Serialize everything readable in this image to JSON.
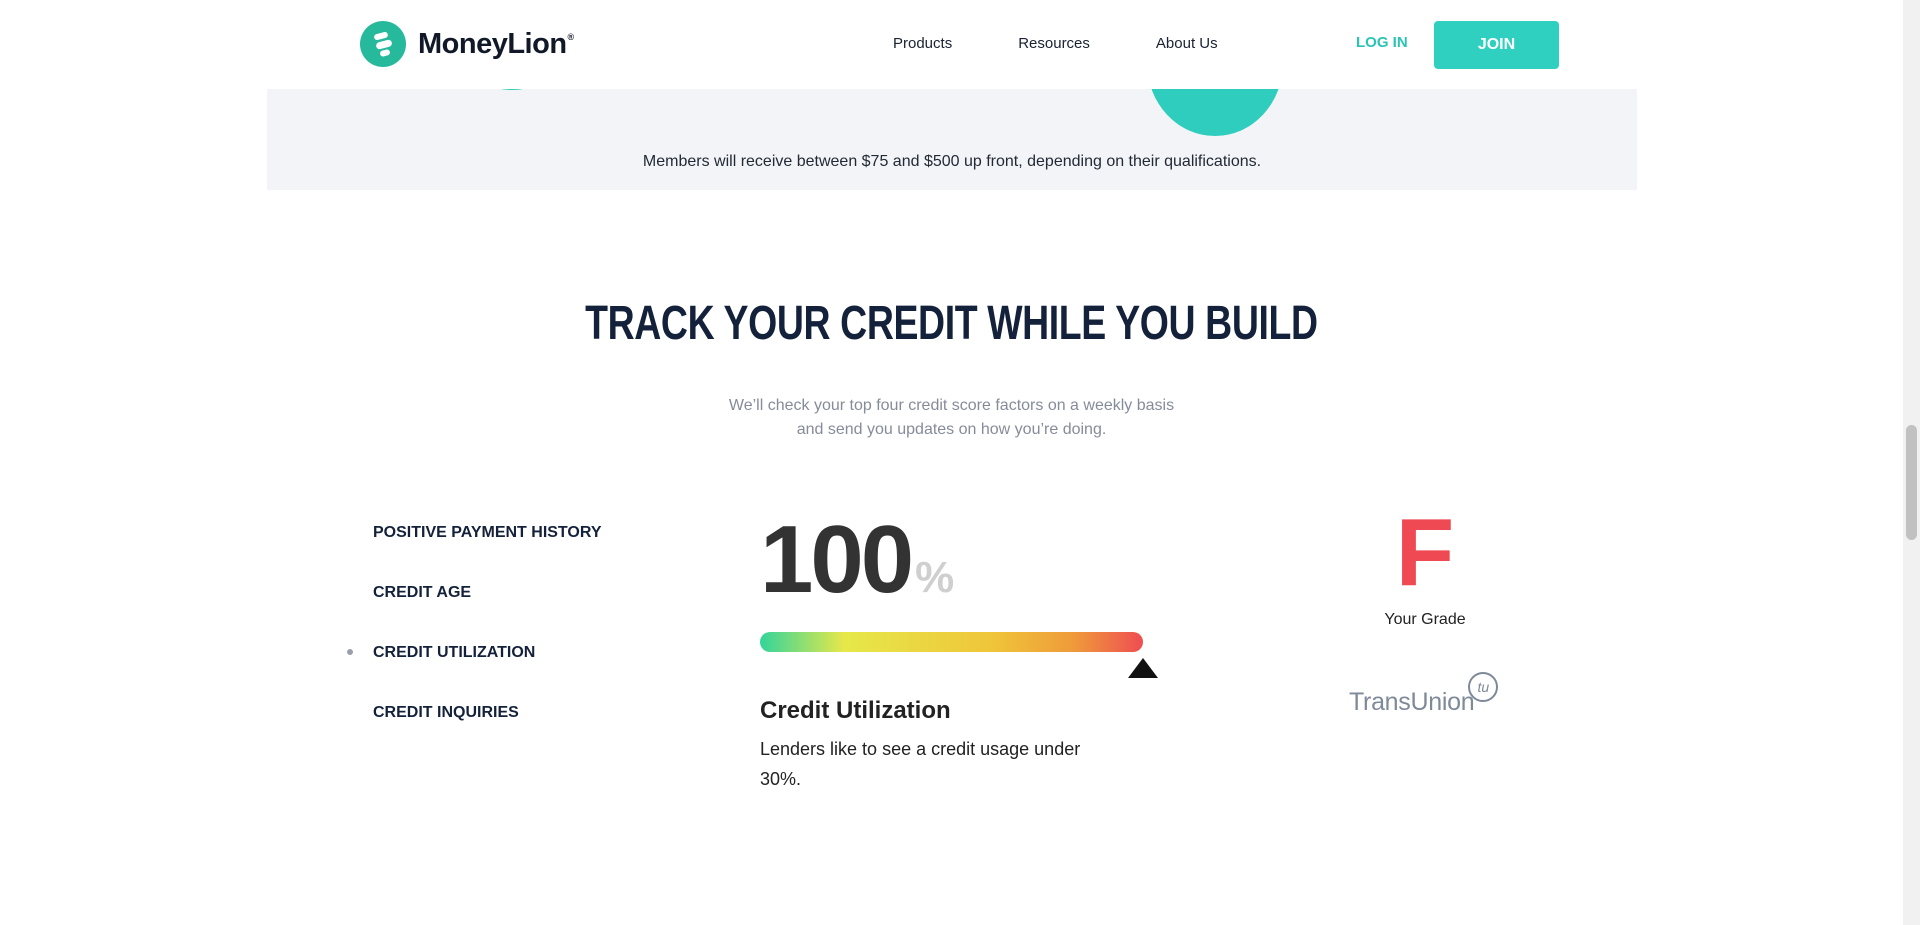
{
  "header": {
    "brand": "MoneyLion",
    "brand_reg": "®",
    "nav": [
      "Products",
      "Resources",
      "About Us"
    ],
    "login": "LOG IN",
    "join": "JOIN"
  },
  "band": {
    "text": "Members will receive between $75 and $500 up front, depending on their qualifications."
  },
  "section": {
    "title": "TRACK YOUR CREDIT WHILE YOU BUILD",
    "subtitle_line1": "We’ll check your top four credit score factors on a weekly basis",
    "subtitle_line2": "and send you updates on how you’re doing."
  },
  "factors": [
    {
      "label": "POSITIVE PAYMENT HISTORY",
      "active": false
    },
    {
      "label": "CREDIT AGE",
      "active": false
    },
    {
      "label": "CREDIT UTILIZATION",
      "active": true
    },
    {
      "label": "CREDIT INQUIRIES",
      "active": false
    }
  ],
  "detail": {
    "value": "100",
    "unit": "%",
    "gauge_level": 1.0,
    "title": "Credit Utilization",
    "description": "Lenders like to see a credit usage under 30%."
  },
  "grade": {
    "letter": "F",
    "label": "Your Grade"
  },
  "bureau": {
    "logo_text": "TransUnion",
    "logo_mark": "tu"
  },
  "colors": {
    "accent": "#2fd0bf",
    "grade": "#ef4a53",
    "heading": "#14213a"
  }
}
